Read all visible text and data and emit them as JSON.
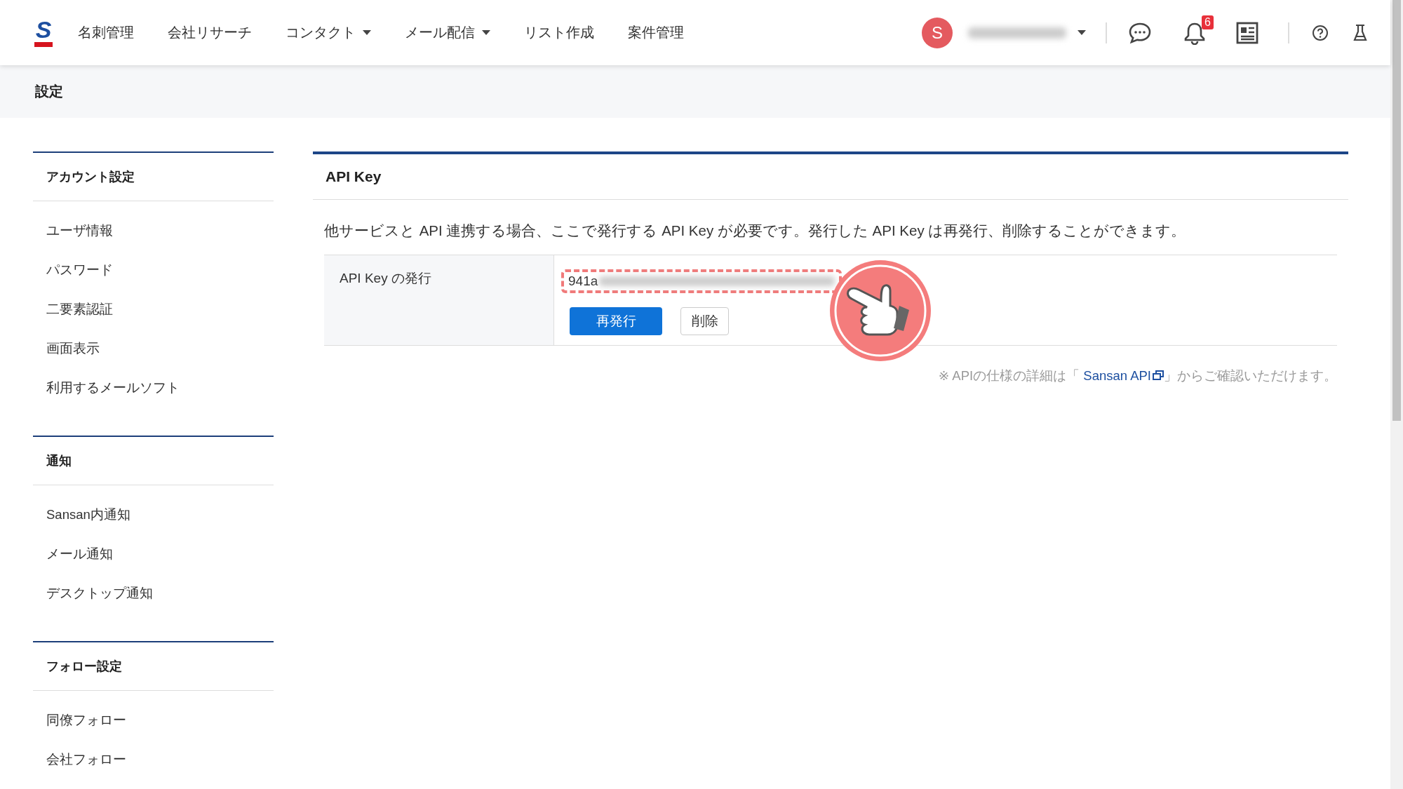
{
  "header": {
    "logo": "S",
    "nav": [
      {
        "label": "名刺管理",
        "dropdown": false
      },
      {
        "label": "会社リサーチ",
        "dropdown": false
      },
      {
        "label": "コンタクト",
        "dropdown": true
      },
      {
        "label": "メール配信",
        "dropdown": true
      },
      {
        "label": "リスト作成",
        "dropdown": false
      },
      {
        "label": "案件管理",
        "dropdown": false
      }
    ],
    "avatar": "S",
    "notification_count": "6"
  },
  "page_title": "設定",
  "sidebar": {
    "sections": [
      {
        "title": "アカウント設定",
        "items": [
          "ユーザ情報",
          "パスワード",
          "二要素認証",
          "画面表示",
          "利用するメールソフト"
        ]
      },
      {
        "title": "通知",
        "items": [
          "Sansan内通知",
          "メール通知",
          "デスクトップ通知"
        ]
      },
      {
        "title": "フォロー設定",
        "items": [
          "同僚フォロー",
          "会社フォロー"
        ]
      }
    ]
  },
  "panel": {
    "title": "API Key",
    "description": "他サービスと API 連携する場合、ここで発行する API Key が必要です。発行した API Key は再発行、削除することができます。",
    "row": {
      "label": "API Key の発行",
      "key_value": "941a",
      "buttons": [
        {
          "label": "再発行",
          "kind": "primary"
        },
        {
          "label": "削除",
          "kind": "secondary"
        }
      ]
    },
    "note": {
      "before": "※ APIの仕様の詳細は「 ",
      "link": "Sansan API",
      "after": "」からご確認いただけます。"
    }
  }
}
